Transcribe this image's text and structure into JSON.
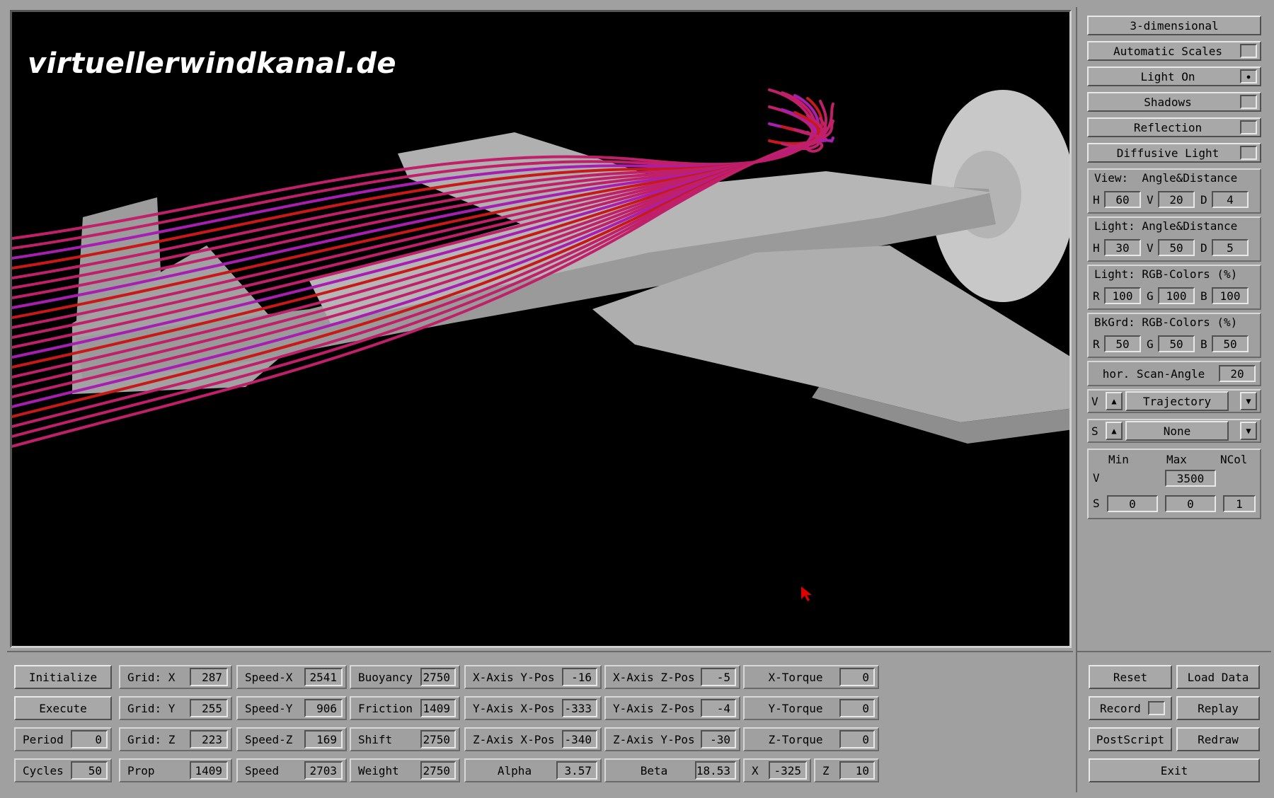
{
  "viewport": {
    "watermark": "virtuellerwindkanal.de"
  },
  "right_panel": {
    "mode_button": "3-dimensional",
    "toggles": [
      {
        "label": "Automatic Scales",
        "checked": false
      },
      {
        "label": "Light On",
        "checked": true
      },
      {
        "label": "Shadows",
        "checked": false
      },
      {
        "label": "Reflection",
        "checked": false
      },
      {
        "label": "Diffusive Light",
        "checked": false
      }
    ],
    "view": {
      "title": "View:  Angle&Distance",
      "h": "60",
      "v": "20",
      "d": "4"
    },
    "light_angle": {
      "title": "Light: Angle&Distance",
      "h": "30",
      "v": "50",
      "d": "5"
    },
    "light_rgb": {
      "title": "Light: RGB-Colors (%)",
      "r": "100",
      "g": "100",
      "b": "100"
    },
    "bkgrd_rgb": {
      "title": "BkGrd: RGB-Colors (%)",
      "r": "50",
      "g": "50",
      "b": "50"
    },
    "scan_angle": {
      "label": "hor. Scan-Angle",
      "value": "20"
    },
    "v_select": {
      "key": "V",
      "value": "Trajectory"
    },
    "s_select": {
      "key": "S",
      "value": "None"
    },
    "range": {
      "min_label": "Min",
      "max_label": "Max",
      "ncol_label": "NCol",
      "v_key": "V",
      "v_max": "3500",
      "s_key": "S",
      "s_min": "0",
      "s_max": "0",
      "s_ncol": "1"
    }
  },
  "bottom": {
    "initialize": "Initialize",
    "execute": "Execute",
    "period": {
      "label": "Period",
      "value": "0"
    },
    "cycles": {
      "label": "Cycles",
      "value": "50"
    },
    "grid_x": {
      "label": "Grid: X",
      "value": "287"
    },
    "grid_y": {
      "label": "Grid: Y",
      "value": "255"
    },
    "grid_z": {
      "label": "Grid: Z",
      "value": "223"
    },
    "prop": {
      "label": "Prop",
      "value": "1409"
    },
    "speed_x": {
      "label": "Speed-X",
      "value": "2541"
    },
    "speed_y": {
      "label": "Speed-Y",
      "value": "906"
    },
    "speed_z": {
      "label": "Speed-Z",
      "value": "169"
    },
    "speed": {
      "label": "Speed",
      "value": "2703"
    },
    "buoyancy": {
      "label": "Buoyancy",
      "value": "2750"
    },
    "friction": {
      "label": "Friction",
      "value": "1409"
    },
    "shift": {
      "label": "Shift",
      "value": "2750"
    },
    "weight": {
      "label": "Weight",
      "value": "2750"
    },
    "xaxis_ypos": {
      "label": "X-Axis Y-Pos",
      "value": "-16"
    },
    "yaxis_xpos": {
      "label": "Y-Axis X-Pos",
      "value": "-333"
    },
    "zaxis_xpos": {
      "label": "Z-Axis X-Pos",
      "value": "-340"
    },
    "alpha": {
      "label": "Alpha",
      "value": "3.57"
    },
    "xaxis_zpos": {
      "label": "X-Axis Z-Pos",
      "value": "-5"
    },
    "yaxis_zpos": {
      "label": "Y-Axis Z-Pos",
      "value": "-4"
    },
    "zaxis_ypos": {
      "label": "Z-Axis Y-Pos",
      "value": "-30"
    },
    "beta": {
      "label": "Beta",
      "value": "18.53"
    },
    "x_torque": {
      "label": "X-Torque",
      "value": "0"
    },
    "y_torque": {
      "label": "Y-Torque",
      "value": "0"
    },
    "z_torque": {
      "label": "Z-Torque",
      "value": "0"
    },
    "x": {
      "label": "X",
      "value": "-325"
    },
    "z": {
      "label": "Z",
      "value": "10"
    }
  },
  "actions": {
    "reset": "Reset",
    "load_data": "Load Data",
    "record": "Record",
    "replay": "Replay",
    "postscript": "PostScript",
    "redraw": "Redraw",
    "exit": "Exit"
  },
  "colors": {
    "panel": "#a0a0a0",
    "viewport_bg": "#000000",
    "model": "#a6a6a6",
    "streamline_magenta": "#c0206a",
    "streamline_red": "#c81818",
    "streamline_purple": "#a81eb0"
  }
}
